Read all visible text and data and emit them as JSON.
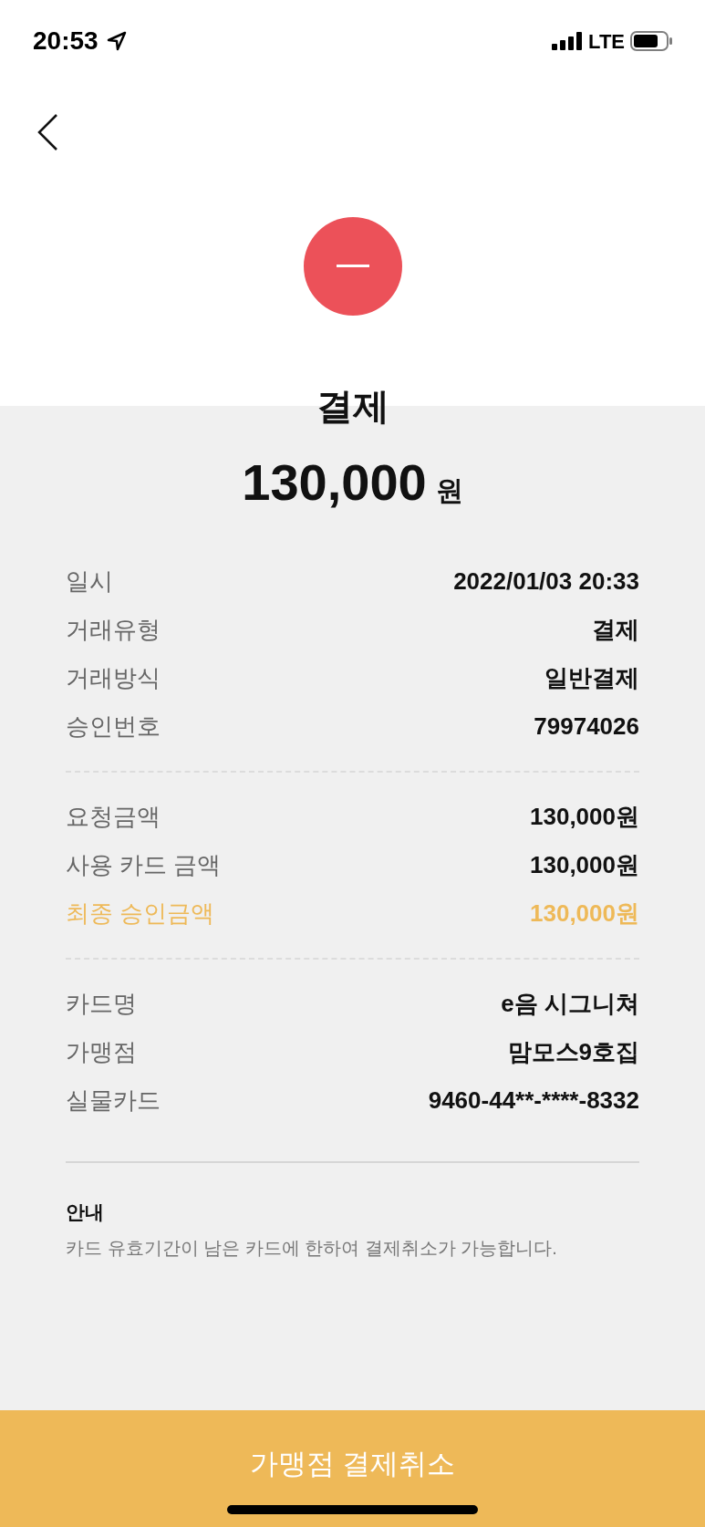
{
  "status_bar": {
    "time": "20:53",
    "network": "LTE"
  },
  "title": "결제",
  "amount": {
    "value": "130,000",
    "unit": "원"
  },
  "detail_groups": [
    {
      "rows": [
        {
          "label": "일시",
          "value": "2022/01/03 20:33",
          "highlighted": false
        },
        {
          "label": "거래유형",
          "value": "결제",
          "highlighted": false
        },
        {
          "label": "거래방식",
          "value": "일반결제",
          "highlighted": false
        },
        {
          "label": "승인번호",
          "value": "79974026",
          "highlighted": false
        }
      ]
    },
    {
      "rows": [
        {
          "label": "요청금액",
          "value": "130,000원",
          "highlighted": false
        },
        {
          "label": "사용 카드 금액",
          "value": "130,000원",
          "highlighted": false
        },
        {
          "label": "최종 승인금액",
          "value": "130,000원",
          "highlighted": true
        }
      ]
    },
    {
      "rows": [
        {
          "label": "카드명",
          "value": "e음 시그니쳐",
          "highlighted": false
        },
        {
          "label": "가맹점",
          "value": "맘모스9호집",
          "highlighted": false
        },
        {
          "label": "실물카드",
          "value": "9460-44**-****-8332",
          "highlighted": false
        }
      ]
    }
  ],
  "notice": {
    "title": "안내",
    "text": "카드 유효기간이 남은 카드에 한하여 결제취소가 가능합니다."
  },
  "primary_button": "가맹점 결제취소"
}
